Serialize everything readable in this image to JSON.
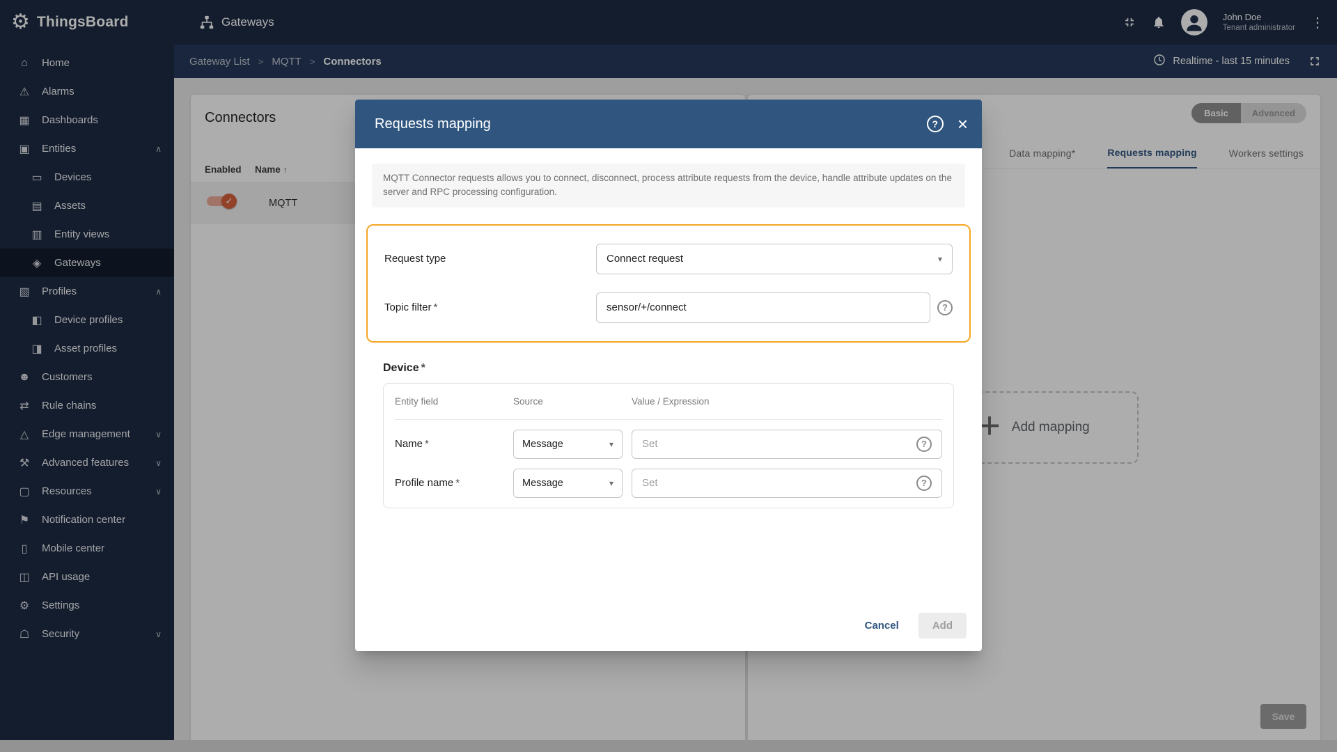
{
  "brand": {
    "name": "ThingsBoard",
    "logo_icon": "⚙"
  },
  "topbar": {
    "page_title": "Gateways",
    "user": {
      "name": "John Doe",
      "role": "Tenant administrator"
    },
    "dots_icon": "⋮"
  },
  "breadcrumb": {
    "separator": ">",
    "items": [
      "Gateway List",
      "MQTT",
      "Connectors"
    ]
  },
  "toolbar": {
    "realtime_label": "Realtime - last 15 minutes"
  },
  "sidebar": {
    "items": [
      {
        "label": "Home",
        "icon": "⌂"
      },
      {
        "label": "Alarms",
        "icon": "⚠"
      },
      {
        "label": "Dashboards",
        "icon": "▦"
      },
      {
        "label": "Entities",
        "icon": "▣",
        "chevron": "∧"
      },
      {
        "label": "Devices",
        "icon": "▭",
        "sub": true
      },
      {
        "label": "Assets",
        "icon": "▤",
        "sub": true
      },
      {
        "label": "Entity views",
        "icon": "▥",
        "sub": true
      },
      {
        "label": "Gateways",
        "icon": "◈",
        "sub": true,
        "active": true
      },
      {
        "label": "Profiles",
        "icon": "▧",
        "chevron": "∧"
      },
      {
        "label": "Device profiles",
        "icon": "◧",
        "sub": true
      },
      {
        "label": "Asset profiles",
        "icon": "◨",
        "sub": true
      },
      {
        "label": "Customers",
        "icon": "☻"
      },
      {
        "label": "Rule chains",
        "icon": "⇄"
      },
      {
        "label": "Edge management",
        "icon": "△",
        "chevron": "∨"
      },
      {
        "label": "Advanced features",
        "icon": "⚒",
        "chevron": "∨"
      },
      {
        "label": "Resources",
        "icon": "▢",
        "chevron": "∨"
      },
      {
        "label": "Notification center",
        "icon": "⚑"
      },
      {
        "label": "Mobile center",
        "icon": "▯"
      },
      {
        "label": "API usage",
        "icon": "◫"
      },
      {
        "label": "Settings",
        "icon": "⚙"
      },
      {
        "label": "Security",
        "icon": "☖",
        "chevron": "∨"
      }
    ]
  },
  "connectors_panel": {
    "title": "Connectors",
    "columns": {
      "enabled": "Enabled",
      "name": "Name",
      "sort_icon": "↑"
    },
    "rows": [
      {
        "name": "MQTT",
        "enabled": true,
        "check_icon": "✓"
      }
    ]
  },
  "details_panel": {
    "mode": {
      "basic": "Basic",
      "advanced": "Advanced"
    },
    "tabs": [
      {
        "label": "Data mapping*"
      },
      {
        "label": "Requests mapping",
        "active": true
      },
      {
        "label": "Workers settings"
      }
    ],
    "add_mapping": {
      "plus": "+",
      "label": "Add mapping"
    },
    "save_label": "Save"
  },
  "modal": {
    "title": "Requests mapping",
    "help_icon": "?",
    "close_icon": "×",
    "description": "MQTT Connector requests allows you to connect, disconnect, process attribute requests from the device, handle attribute updates on the server and RPC processing configuration.",
    "request_type": {
      "label": "Request type",
      "value": "Connect request",
      "arrow": "▾"
    },
    "topic_filter": {
      "label": "Topic filter",
      "required_mark": "*",
      "value": "sensor/+/connect",
      "help_icon": "?"
    },
    "device": {
      "title": "Device",
      "required_mark": "*",
      "columns": [
        "Entity field",
        "Source",
        "Value / Expression"
      ],
      "rows": [
        {
          "field": "Name",
          "required_mark": "*",
          "source": "Message",
          "arrow": "▾",
          "value_placeholder": "Set",
          "help_icon": "?"
        },
        {
          "field": "Profile name",
          "required_mark": "*",
          "source": "Message",
          "arrow": "▾",
          "value_placeholder": "Set",
          "help_icon": "?"
        }
      ]
    },
    "actions": {
      "cancel": "Cancel",
      "add": "Add"
    }
  },
  "colors": {
    "primary": "#305680",
    "sidebar_bg": "#1c2b45",
    "breadcrumb_bg": "#25395a",
    "highlight_border": "#f5a623",
    "toggle_on": "#d9603d"
  }
}
